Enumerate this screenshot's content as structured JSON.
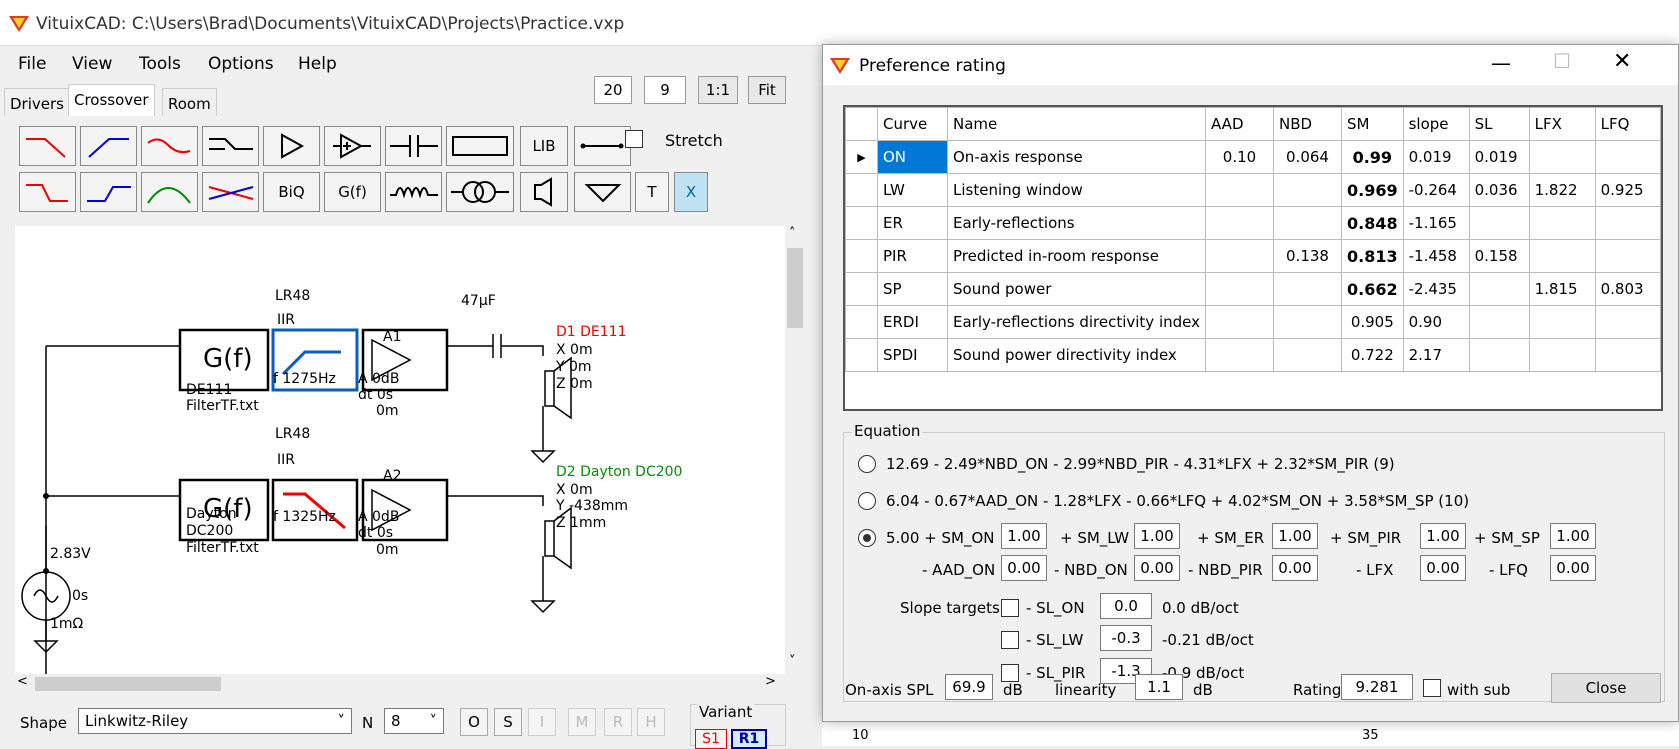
{
  "app": {
    "title": "VituixCAD: C:\\Users\\Brad\\Documents\\VituixCAD\\Projects\\Practice.vxp",
    "menu": [
      "File",
      "View",
      "Tools",
      "Options",
      "Help"
    ],
    "tabs": [
      "Drivers",
      "Crossover",
      "Room"
    ],
    "zoom": {
      "a": "20",
      "b": "9",
      "ratio": "1:1",
      "fit": "Fit"
    },
    "toolbar": {
      "lib": "LIB",
      "stretch": "Stretch",
      "biq": "BiQ",
      "gf": "G(f)",
      "t": "T",
      "x": "X"
    }
  },
  "schematic": {
    "ch1": {
      "gf": "G(f)",
      "gf_label1": "DE111",
      "gf_label2": "FilterTF.txt",
      "lr": "LR48",
      "iir": "IIR",
      "f": "f   1275Hz",
      "amp": "A1",
      "amp_a": "A  0dB",
      "amp_dt": "dt 0s",
      "amp_m": "0m",
      "cap": "47µF",
      "drv": "D1 DE111",
      "x": "X 0m",
      "y": "Y 0m",
      "z": "Z 0m"
    },
    "ch2": {
      "gf": "G(f)",
      "gf_label1": "Dayton",
      "gf_label2": "DC200",
      "gf_label3": "FilterTF.txt",
      "lr": "LR48",
      "iir": "IIR",
      "f": "f   1325Hz",
      "amp": "A2",
      "amp_a": "A  0dB",
      "amp_dt": "dt 0s",
      "amp_m": "0m",
      "drv": "D2 Dayton DC200",
      "x": "X 0m",
      "y": "Y -438mm",
      "z": "Z 1mm"
    },
    "source": {
      "v": "2.83V",
      "t": "0s",
      "r": "1mΩ"
    }
  },
  "bottom": {
    "shape_label": "Shape",
    "shape_value": "Linkwitz-Riley",
    "n_label": "N",
    "n_value": "8",
    "btns": [
      "O",
      "S",
      "I",
      "M",
      "R",
      "H"
    ],
    "variant": "Variant",
    "s1": "S1",
    "r1": "R1"
  },
  "dialog": {
    "title": "Preference rating",
    "columns": [
      "Curve",
      "Name",
      "AAD",
      "NBD",
      "SM",
      "slope",
      "SL",
      "LFX",
      "LFQ"
    ],
    "rows": [
      {
        "curve": "ON",
        "name": "On-axis response",
        "aad": "0.10",
        "nbd": "0.064",
        "sm": "0.99",
        "slope": "0.019",
        "sl": "0.019",
        "lfx": "",
        "lfq": ""
      },
      {
        "curve": "LW",
        "name": "Listening window",
        "aad": "",
        "nbd": "",
        "sm": "0.969",
        "slope": "-0.264",
        "sl": "0.036",
        "lfx": "1.822",
        "lfq": "0.925"
      },
      {
        "curve": "ER",
        "name": "Early-reflections",
        "aad": "",
        "nbd": "",
        "sm": "0.848",
        "slope": "-1.165",
        "sl": "",
        "lfx": "",
        "lfq": ""
      },
      {
        "curve": "PIR",
        "name": "Predicted in-room response",
        "aad": "",
        "nbd": "0.138",
        "sm": "0.813",
        "slope": "-1.458",
        "sl": "0.158",
        "lfx": "",
        "lfq": ""
      },
      {
        "curve": "SP",
        "name": "Sound power",
        "aad": "",
        "nbd": "",
        "sm": "0.662",
        "slope": "-2.435",
        "sl": "",
        "lfx": "1.815",
        "lfq": "0.803"
      },
      {
        "curve": "ERDI",
        "name": "Early-reflections directivity index",
        "aad": "",
        "nbd": "",
        "sm": "0.905",
        "slope": "0.90",
        "sl": "",
        "lfx": "",
        "lfq": ""
      },
      {
        "curve": "SPDI",
        "name": "Sound power directivity index",
        "aad": "",
        "nbd": "",
        "sm": "0.722",
        "slope": "2.17",
        "sl": "",
        "lfx": "",
        "lfq": ""
      }
    ],
    "equation_label": "Equation",
    "eq1": "12.69 - 2.49*NBD_ON - 2.99*NBD_PIR - 4.31*LFX + 2.32*SM_PIR (9)",
    "eq2": "6.04 - 0.67*AAD_ON - 1.28*LFX - 0.66*LFQ + 4.02*SM_ON + 3.58*SM_SP (10)",
    "eq3": {
      "base": "5.00 + SM_ON",
      "sm_on": "1.00",
      "sm_lw_l": "+ SM_LW",
      "sm_lw": "1.00",
      "sm_er_l": "+ SM_ER",
      "sm_er": "1.00",
      "sm_pir_l": "+ SM_PIR",
      "sm_pir": "1.00",
      "sm_sp_l": "+ SM_SP",
      "sm_sp": "1.00",
      "aad_on_l": "- AAD_ON",
      "aad_on": "0.00",
      "nbd_on_l": "- NBD_ON",
      "nbd_on": "0.00",
      "nbd_pir_l": "- NBD_PIR",
      "nbd_pir": "0.00",
      "lfx_l": "- LFX",
      "lfx": "0.00",
      "lfq_l": "- LFQ",
      "lfq": "0.00"
    },
    "slope_targets": "Slope targets",
    "sl_on": {
      "label": "- SL_ON",
      "value": "0.0",
      "unit": "0.0 dB/oct"
    },
    "sl_lw": {
      "label": "- SL_LW",
      "value": "-0.3",
      "unit": "-0.21 dB/oct"
    },
    "sl_pir": {
      "label": "- SL_PIR",
      "value": "-1.3",
      "unit": "-0.9 dB/oct"
    },
    "footer": {
      "spl_label": "On-axis SPL",
      "spl": "69.9",
      "db1": "dB",
      "lin_label": "linearity",
      "lin": "1.1",
      "db2": "dB",
      "rating_label": "Rating",
      "rating": "9.281",
      "with_sub": "with sub",
      "close": "Close"
    }
  },
  "bg_chart": {
    "left_tick": "10",
    "right_tick": "35"
  }
}
